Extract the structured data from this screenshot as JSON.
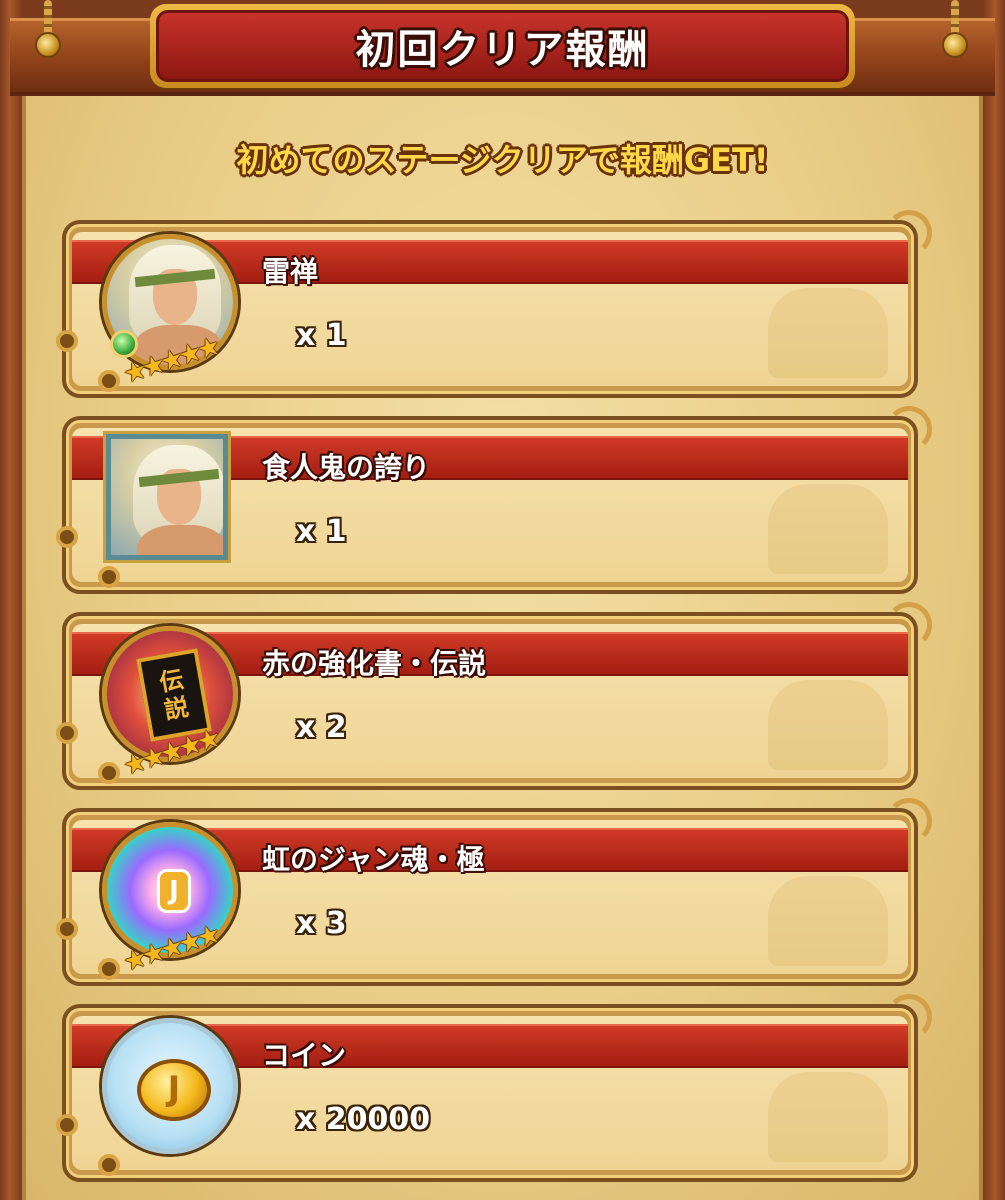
{
  "header": {
    "title": "初回クリア報酬",
    "subtitle": "初めてのステージクリアで報酬GET!"
  },
  "rewards": [
    {
      "name": "雷禅",
      "quantity": "x 1",
      "icon": "character-portrait-icon",
      "rarity_stars": 5
    },
    {
      "name": "食人鬼の誇り",
      "quantity": "x 1",
      "icon": "character-card-icon",
      "rarity_stars": 0
    },
    {
      "name": "赤の強化書・伝説",
      "quantity": "x 2",
      "icon": "enhancement-book-icon",
      "icon_text_top": "伝",
      "icon_text_bottom": "説",
      "rarity_stars": 5
    },
    {
      "name": "虹のジャン魂・極",
      "quantity": "x 3",
      "icon": "rainbow-soul-icon",
      "icon_text": "J",
      "rarity_stars": 5
    },
    {
      "name": "コイン",
      "quantity": "x 20000",
      "icon": "coin-icon",
      "icon_text": "J",
      "rarity_stars": 0
    }
  ],
  "colors": {
    "header_red": "#a41e12",
    "gold": "#f4b81c",
    "parchment": "#f3dfa6",
    "wood": "#7a3a1c"
  }
}
